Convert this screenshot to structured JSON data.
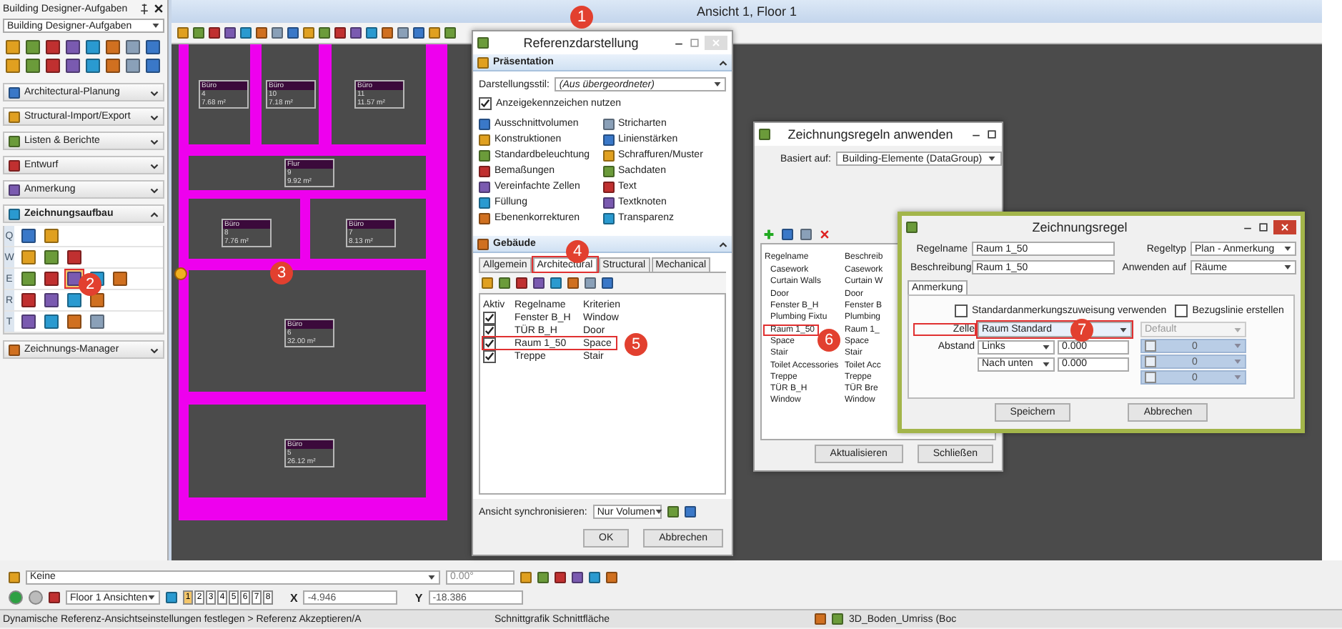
{
  "left_panel": {
    "title": "Building Designer-Aufgaben",
    "dropdown": "Building Designer-Aufgaben",
    "sections": [
      {
        "label": "Architectural-Planung",
        "expanded": false
      },
      {
        "label": "Structural-Import/Export",
        "expanded": false
      },
      {
        "label": "Listen & Berichte",
        "expanded": false
      },
      {
        "label": "Entwurf",
        "expanded": false
      },
      {
        "label": "Anmerkung",
        "expanded": false
      },
      {
        "label": "Zeichnungsaufbau",
        "expanded": true,
        "rows": [
          {
            "key": "Q",
            "tools": [
              {
                "selected": false,
                "marked": false
              },
              {
                "selected": false,
                "marked": false
              }
            ]
          },
          {
            "key": "W",
            "tools": [
              {
                "selected": false,
                "marked": false
              },
              {
                "selected": false,
                "marked": false
              },
              {
                "selected": false,
                "marked": false
              }
            ]
          },
          {
            "key": "E",
            "tools": [
              {
                "selected": false,
                "marked": false
              },
              {
                "selected": false,
                "marked": false
              },
              {
                "selected": true,
                "marked": true
              },
              {
                "selected": false,
                "marked": false
              },
              {
                "selected": false,
                "marked": false
              }
            ]
          },
          {
            "key": "R",
            "tools": [
              {
                "selected": false,
                "marked": false
              },
              {
                "selected": false,
                "marked": false
              },
              {
                "selected": false,
                "marked": false
              },
              {
                "selected": false,
                "marked": false
              }
            ]
          },
          {
            "key": "T",
            "tools": [
              {
                "selected": false,
                "marked": false
              },
              {
                "selected": false,
                "marked": false
              },
              {
                "selected": false,
                "marked": false
              },
              {
                "selected": false,
                "marked": false
              }
            ]
          }
        ]
      },
      {
        "label": "Zeichnungs-Manager",
        "expanded": false
      }
    ]
  },
  "view": {
    "title": "Ansicht 1, Floor 1",
    "rooms": [
      {
        "name": "Büro",
        "number": "4",
        "area": "7.68 m²"
      },
      {
        "name": "Büro",
        "number": "10",
        "area": "7.18 m²"
      },
      {
        "name": "Büro",
        "number": "11",
        "area": "11.57 m²"
      },
      {
        "name": "Flur",
        "number": "9",
        "area": "9.92 m²"
      },
      {
        "name": "Büro",
        "number": "8",
        "area": "7.76 m²"
      },
      {
        "name": "Büro",
        "number": "7",
        "area": "8.13 m²"
      },
      {
        "name": "Büro",
        "number": "6",
        "area": "32.00 m²"
      },
      {
        "name": "Büro",
        "number": "5",
        "area": "26.12 m²"
      }
    ]
  },
  "reference_dialog": {
    "title": "Referenzdarstellung",
    "presentation": {
      "label": "Präsentation",
      "expanded": true,
      "style_label": "Darstellungsstil:",
      "style_value": "(Aus übergeordneter)",
      "flag": {
        "label": "Anzeigekennzeichen nutzen",
        "checked": true
      },
      "items": [
        {
          "label": "Ausschnittvolumen"
        },
        {
          "label": "Konstruktionen"
        },
        {
          "label": "Standardbeleuchtung"
        },
        {
          "label": "Bemaßungen"
        },
        {
          "label": "Vereinfachte Zellen"
        },
        {
          "label": "Füllung"
        },
        {
          "label": "Ebenenkorrekturen"
        },
        {
          "label": "Stricharten"
        },
        {
          "label": "Linienstärken"
        },
        {
          "label": "Schraffuren/Muster"
        },
        {
          "label": "Sachdaten"
        },
        {
          "label": "Text"
        },
        {
          "label": "Textknoten"
        },
        {
          "label": "Transparenz"
        }
      ]
    },
    "building": {
      "label": "Gebäude",
      "expanded": true,
      "tabs": [
        {
          "label": "Allgemein",
          "selected": false,
          "marked": false
        },
        {
          "label": "Architectural",
          "selected": true,
          "marked": true
        },
        {
          "label": "Structural",
          "selected": false,
          "marked": false
        },
        {
          "label": "Mechanical",
          "selected": false,
          "marked": false
        }
      ],
      "columns": [
        "Aktiv",
        "Regelname",
        "Kriterien"
      ],
      "rows": [
        {
          "active": true,
          "name": "Fenster B_H",
          "criteria": "Window",
          "marked": false
        },
        {
          "active": true,
          "name": "TÜR B_H",
          "criteria": "Door",
          "marked": false
        },
        {
          "active": true,
          "name": "Raum 1_50",
          "criteria": "Space",
          "marked": true
        },
        {
          "active": true,
          "name": "Treppe",
          "criteria": "Stair",
          "marked": false
        }
      ]
    },
    "sync_label": "Ansicht synchronisieren:",
    "sync_value": "Nur Volumen",
    "buttons": [
      "OK",
      "Abbrechen"
    ]
  },
  "rules_dialog": {
    "title": "Zeichnungsregeln anwenden",
    "based_on_label": "Basiert auf:",
    "based_on_value": "Building-Elemente (DataGroup)",
    "columns": [
      "Regelname",
      "Beschreib"
    ],
    "rows": [
      {
        "name": "Casework",
        "description": "Casework",
        "marked": false
      },
      {
        "name": "Curtain Walls",
        "description": "Curtain W",
        "marked": false
      },
      {
        "name": "Door",
        "description": "Door",
        "marked": false
      },
      {
        "name": "Fenster B_H",
        "description": "Fenster B",
        "marked": false
      },
      {
        "name": "Plumbing Fixtu",
        "description": "Plumbing",
        "marked": false
      },
      {
        "name": "Raum 1_50",
        "description": "Raum 1_",
        "marked": true
      },
      {
        "name": "Space",
        "description": "Space",
        "marked": false
      },
      {
        "name": "Stair",
        "description": "Stair",
        "marked": false
      },
      {
        "name": "Toilet Accessories",
        "description": "Toilet Acc",
        "marked": false
      },
      {
        "name": "Treppe",
        "description": "Treppe",
        "marked": false
      },
      {
        "name": "TÜR B_H",
        "description": "TÜR Bre",
        "marked": false
      },
      {
        "name": "Window",
        "description": "Window",
        "marked": false
      }
    ],
    "buttons": [
      "Aktualisieren",
      "Schließen"
    ]
  },
  "rule_dialog": {
    "title": "Zeichnungsregel",
    "fields": [
      {
        "label": "Regelname",
        "value": "Raum 1_50"
      },
      {
        "label": "Beschreibung",
        "value": "Raum 1_50"
      }
    ],
    "selects": [
      {
        "label": "Regeltyp",
        "value": "Plan - Anmerkung"
      },
      {
        "label": "Anwenden auf",
        "value": "Räume"
      }
    ],
    "tab": "Anmerkung",
    "checkboxes": [
      {
        "label": "Standardanmerkungszuweisung verwenden",
        "checked": false
      },
      {
        "label": "Bezugslinie erstellen",
        "checked": false
      }
    ],
    "cell_label": "Zelle",
    "cell_value": "Raum Standard",
    "cell_marked": true,
    "default_value": "Default",
    "offset_label": "Abstand",
    "offsets": [
      {
        "direction": "Links",
        "value": "0.000"
      },
      {
        "direction": "Nach unten",
        "value": "0.000"
      }
    ],
    "grid_values": [
      "0",
      "0",
      "0"
    ],
    "buttons": [
      "Speichern",
      "Abbrechen"
    ]
  },
  "bottom_toolbar": {
    "level_dropdown": "Keine",
    "angle": "0.00°",
    "views_dropdown": "Floor 1 Ansichten",
    "view_buttons": [
      {
        "label": "1",
        "selected": true
      },
      {
        "label": "2",
        "selected": false
      },
      {
        "label": "3",
        "selected": false
      },
      {
        "label": "4",
        "selected": false
      },
      {
        "label": "5",
        "selected": false
      },
      {
        "label": "6",
        "selected": false
      },
      {
        "label": "7",
        "selected": false
      },
      {
        "label": "8",
        "selected": false
      }
    ],
    "x_label": "X",
    "x_value": "-4.946",
    "y_label": "Y",
    "y_value": "-18.386"
  },
  "status_bar": {
    "message": "Dynamische Referenz-Ansichtseinstellungen festlegen > Referenz Akzeptieren/A",
    "snap": "Schnittgrafik Schnittfläche",
    "level": "3D_Boden_Umriss (Boc"
  },
  "callouts": [
    "1",
    "2",
    "3",
    "4",
    "5",
    "6",
    "7"
  ]
}
